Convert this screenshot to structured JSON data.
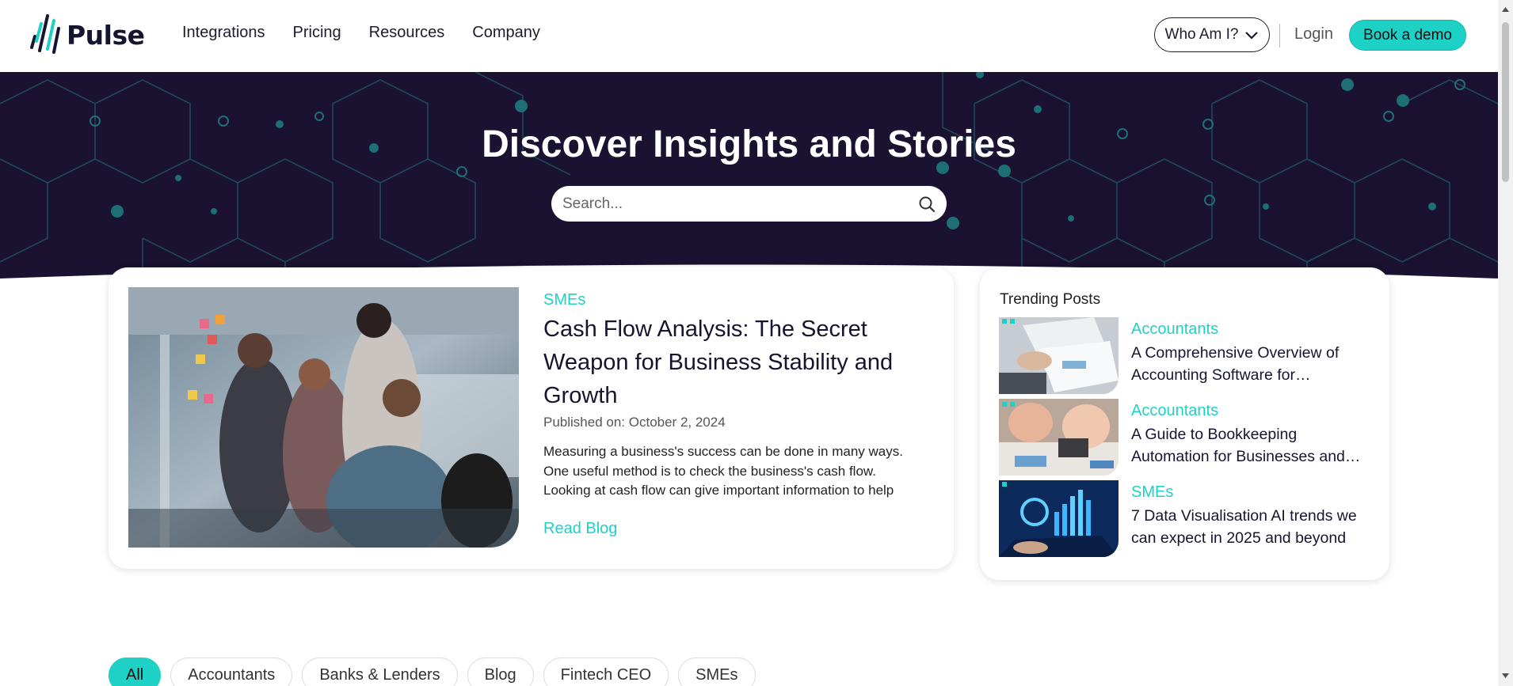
{
  "header": {
    "brand": "Pulse",
    "nav": [
      "Integrations",
      "Pricing",
      "Resources",
      "Company"
    ],
    "who_label": "Who Am I?",
    "login_label": "Login",
    "demo_label": "Book a demo"
  },
  "hero": {
    "title": "Discover Insights and Stories",
    "search_placeholder": "Search..."
  },
  "featured": {
    "tag": "SMEs",
    "title": "Cash Flow Analysis: The Secret Weapon for Business Stability and Growth",
    "date": "Published on: October 2, 2024",
    "excerpt": "Measuring a business's success can be done in many ways. One useful method is to check the business's cash flow. Looking at cash flow can give important information to help",
    "read_label": "Read Blog"
  },
  "trending": {
    "title": "Trending Posts",
    "items": [
      {
        "tag": "Accountants",
        "text": "A Comprehensive Overview of Accounting Software for…"
      },
      {
        "tag": "Accountants",
        "text": "A Guide to Bookkeeping Automation for Businesses and…"
      },
      {
        "tag": "SMEs",
        "text": "7 Data Visualisation AI trends we can expect in 2025 and beyond"
      }
    ]
  },
  "filters": [
    "All",
    "Accountants",
    "Banks & Lenders",
    "Blog",
    "Fintech CEO",
    "SMEs"
  ],
  "active_filter": "All",
  "colors": {
    "accent": "#1ed1c7",
    "hero_bg": "#1a1230",
    "text_dark": "#151530"
  }
}
